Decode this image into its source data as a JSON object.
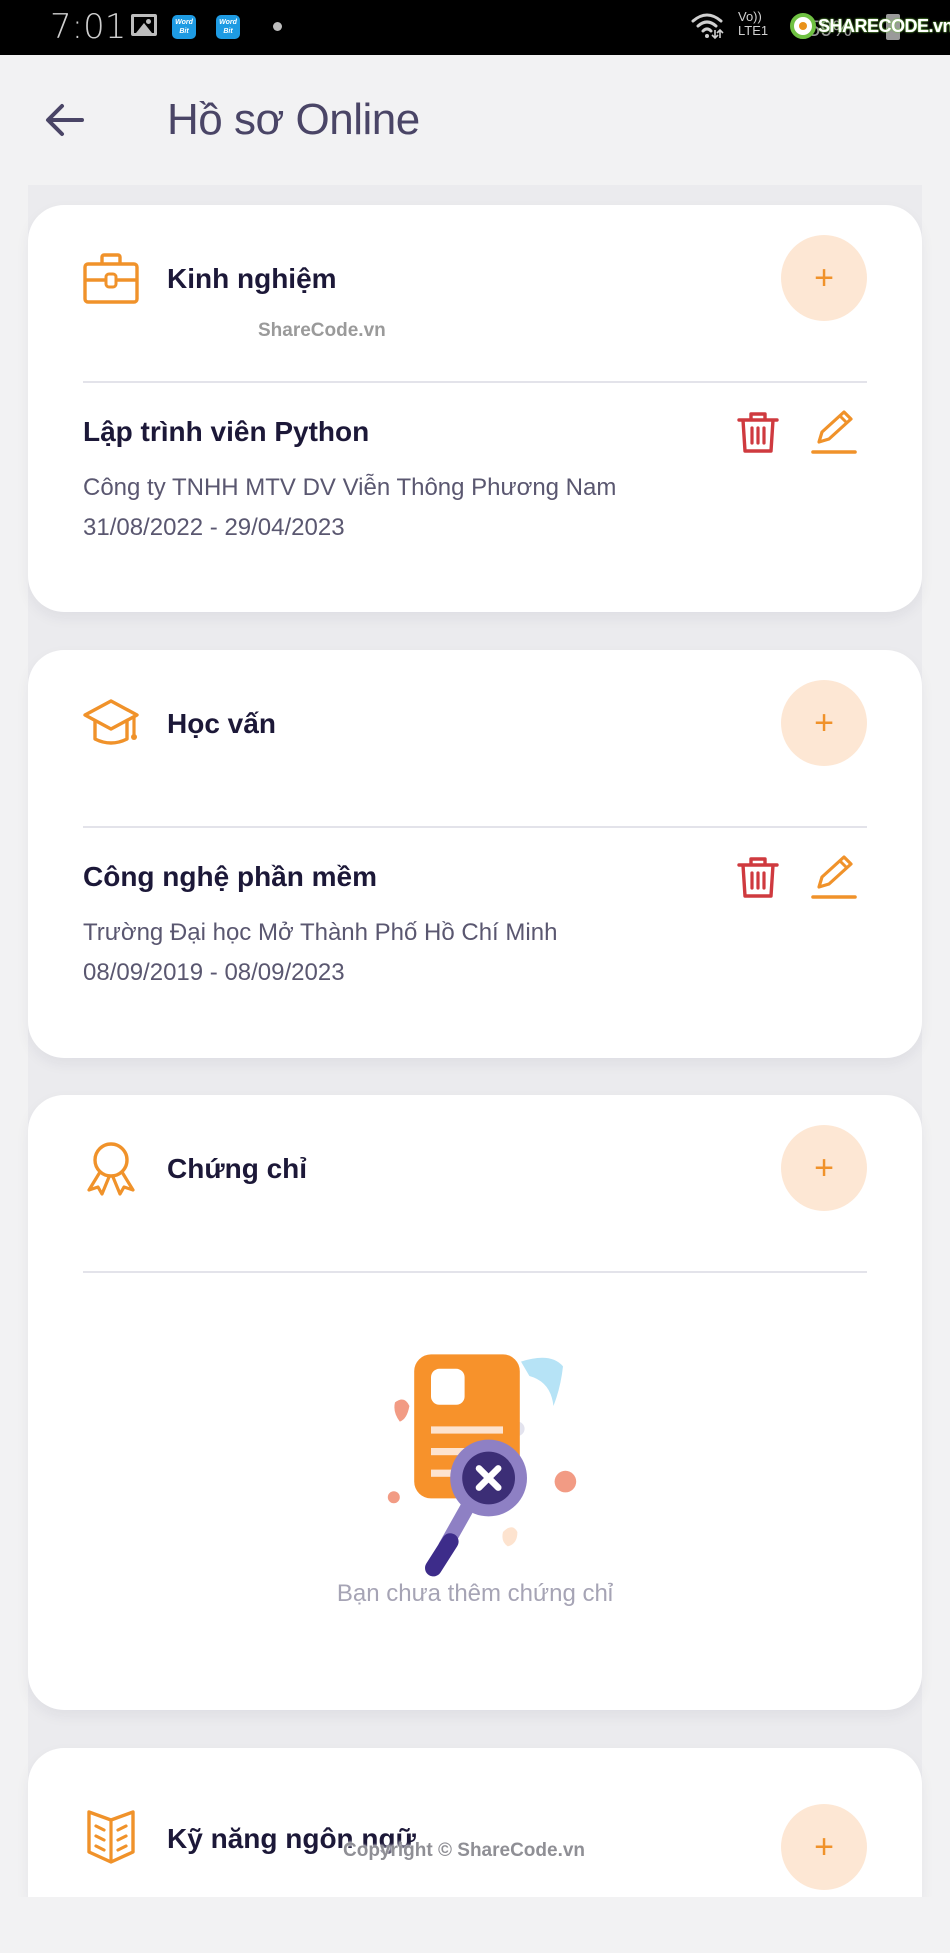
{
  "status_bar": {
    "time": "7:01",
    "notification_icons": [
      "gallery-icon",
      "wordbit-icon",
      "wordbit-icon",
      "dot-icon"
    ],
    "wordbit_label_line1": "Word",
    "wordbit_label_line2": "Bit",
    "network_label_top": "Vo))",
    "network_label_bottom": "LTE1",
    "signal": ".ıl",
    "battery_text": "59%",
    "brand_watermark": "SHARECODE.vn"
  },
  "header": {
    "back_icon": "arrow-left-icon",
    "title": "Hồ sơ Online"
  },
  "colors": {
    "accent": "#f0922a",
    "accent_soft": "#fde7d4",
    "delete": "#cf3a3f",
    "title_text": "#1c1838",
    "header_text": "#4a4566",
    "muted_text": "#5a5770",
    "empty_text": "#a6a4b5"
  },
  "sections": [
    {
      "id": "experience",
      "icon": "briefcase-icon",
      "title": "Kinh nghiệm",
      "add_label": "+",
      "entries": [
        {
          "title": "Lập trình viên Python",
          "subtitle": "Công ty TNHH MTV DV Viễn Thông Phương Nam",
          "date_range": "31/08/2022 - 29/04/2023"
        }
      ]
    },
    {
      "id": "education",
      "icon": "graduation-cap-icon",
      "title": "Học vấn",
      "add_label": "+",
      "entries": [
        {
          "title": "Công nghệ phần mềm",
          "subtitle": "Trường Đại học Mở Thành Phố Hồ Chí Minh",
          "date_range": "08/09/2019 - 08/09/2023"
        }
      ]
    },
    {
      "id": "certificates",
      "icon": "award-icon",
      "title": "Chứng chỉ",
      "add_label": "+",
      "entries": [],
      "empty_message": "Bạn chưa thêm chứng chỉ"
    },
    {
      "id": "languages",
      "icon": "open-book-icon",
      "title": "Kỹ năng ngôn ngữ",
      "add_label": "+"
    }
  ],
  "watermarks": {
    "top": "ShareCode.vn",
    "bottom": "Copyright © ShareCode.vn"
  }
}
